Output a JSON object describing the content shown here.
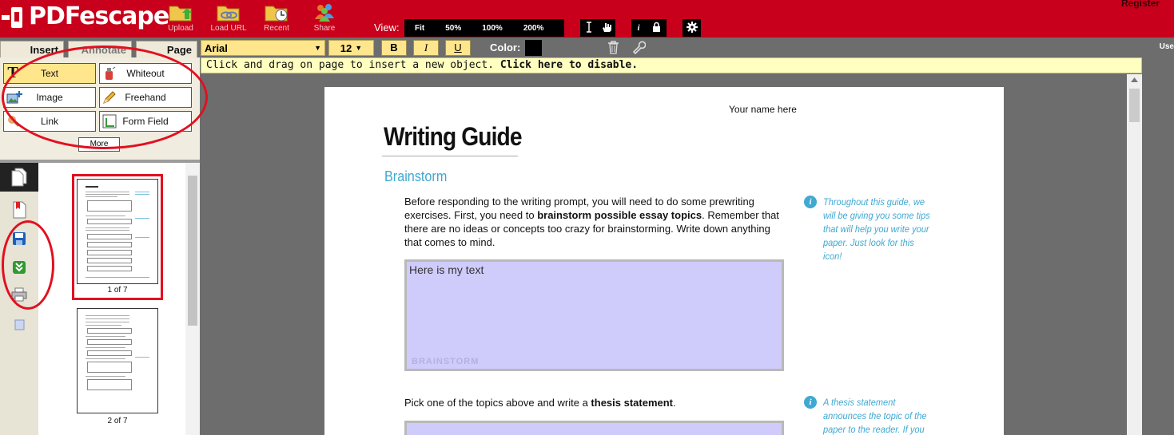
{
  "app": {
    "logo_text": "PDFescape",
    "register": "Register"
  },
  "toolbar": {
    "upload": "Upload",
    "load_url": "Load URL",
    "recent": "Recent",
    "share": "Share"
  },
  "view": {
    "label": "View:",
    "options": [
      "Fit",
      "50%",
      "100%",
      "200%"
    ]
  },
  "tabs": {
    "insert": "Insert",
    "annotate": "Annotate",
    "page": "Page"
  },
  "format": {
    "font": "Arial",
    "size": "12",
    "bold": "B",
    "italic": "I",
    "underline": "U",
    "color_label": "Color:",
    "color_value": "#000000"
  },
  "user_cut": "Use",
  "insert_tools": {
    "text": "Text",
    "whiteout": "Whiteout",
    "image": "Image",
    "freehand": "Freehand",
    "link": "Link",
    "form_field": "Form Field",
    "more": "More"
  },
  "notice": {
    "text": "Click and drag on page to insert a new object. ",
    "link": "Click here to disable."
  },
  "thumbnails": [
    {
      "caption": "1 of 7"
    },
    {
      "caption": "2 of 7"
    }
  ],
  "document": {
    "name_placeholder": "Your name here",
    "title": "Writing Guide",
    "section": "Brainstorm",
    "para1_a": "Before responding to the writing prompt, you will need to do some prewriting exercises. First, you need to ",
    "para1_bold": "brainstorm possible essay topics",
    "para1_b": ". Remember that there are no ideas or concepts too crazy for brainstorming. Write down anything that comes to mind.",
    "field1_text": "Here is my text",
    "field1_label": "BRAINSTORM",
    "para2_a": "Pick one of the topics above and write a ",
    "para2_bold": "thesis statement",
    "para2_b": ".",
    "tip1": "Throughout this guide, we will be giving you some tips that will help you write your paper. Just look for this icon!",
    "tip2": "A thesis statement announces the topic of the paper to the reader. If you find it hard to",
    "tip_icon": "i"
  },
  "colors": {
    "brand_red": "#c8001b",
    "accent_yellow": "#ffe68c",
    "field_purple": "#cfcbfb",
    "tip_blue": "#40a9d1",
    "annotation_red": "#e21020"
  }
}
